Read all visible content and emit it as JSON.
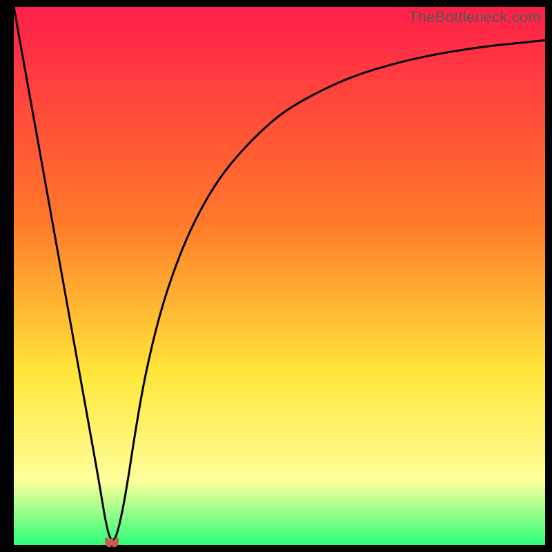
{
  "watermark": "TheBottleneck.com",
  "colors": {
    "top": "#ff1f4a",
    "orange": "#ff7a2a",
    "yellow": "#ffe63a",
    "pale_yellow": "#ffff9a",
    "green": "#2cff7a",
    "curve": "#000000",
    "marker": "#cc5a4a",
    "frame": "#000000"
  },
  "chart_data": {
    "type": "line",
    "title": "",
    "xlabel": "",
    "ylabel": "",
    "xlim": [
      0,
      100
    ],
    "ylim": [
      0,
      100
    ],
    "series": [
      {
        "name": "bottleneck-curve",
        "x": [
          0,
          2,
          4,
          6,
          8,
          10,
          12,
          14,
          16,
          17.5,
          18.5,
          19.5,
          21,
          23,
          25,
          28,
          32,
          36,
          40,
          45,
          50,
          55,
          60,
          65,
          70,
          75,
          80,
          85,
          90,
          95,
          100
        ],
        "y": [
          100,
          89,
          78,
          67,
          56,
          45,
          34,
          23,
          12,
          3,
          0.5,
          2,
          9,
          22,
          33,
          45,
          56,
          64,
          70,
          75.5,
          80,
          83,
          85.5,
          87.5,
          89,
          90.3,
          91.3,
          92.1,
          92.8,
          93.3,
          93.8
        ]
      }
    ],
    "annotations": [
      {
        "name": "optimal-marker",
        "x": 18.5,
        "y": 0.5
      }
    ],
    "gradient_stops_pct": [
      {
        "pct": 0,
        "color_key": "top"
      },
      {
        "pct": 40,
        "color_key": "orange"
      },
      {
        "pct": 68,
        "color_key": "yellow"
      },
      {
        "pct": 88,
        "color_key": "pale_yellow"
      },
      {
        "pct": 100,
        "color_key": "green"
      }
    ]
  }
}
